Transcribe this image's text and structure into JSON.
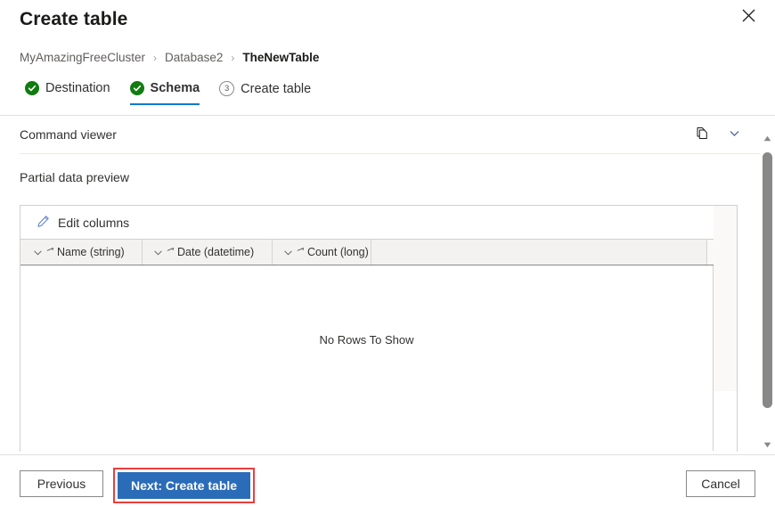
{
  "dialog": {
    "title": "Create table",
    "close_icon": "close-icon"
  },
  "breadcrumb": {
    "items": [
      {
        "label": "MyAmazingFreeCluster",
        "current": false
      },
      {
        "label": "Database2",
        "current": false
      },
      {
        "label": "TheNewTable",
        "current": true
      }
    ],
    "separator": "›"
  },
  "steps": [
    {
      "label": "Destination",
      "state": "done",
      "icon": "check-circle-icon"
    },
    {
      "label": "Schema",
      "state": "active-done",
      "icon": "check-circle-icon"
    },
    {
      "label": "Create table",
      "state": "pending",
      "number": "3"
    }
  ],
  "command_viewer": {
    "label": "Command viewer",
    "copy_icon": "copy-icon",
    "expand_icon": "chevron-down-icon"
  },
  "preview": {
    "label": "Partial data preview",
    "edit_columns_label": "Edit columns",
    "edit_icon": "pencil-icon",
    "add_column_icon": "plus-icon",
    "empty_message": "No Rows To Show",
    "columns": [
      {
        "name": "Name",
        "type": "string",
        "label": "Name (string)",
        "sort_icon": "chevron-down-icon",
        "type_icon": "string-type-icon"
      },
      {
        "name": "Date",
        "type": "datetime",
        "label": "Date (datetime)",
        "sort_icon": "chevron-down-icon",
        "type_icon": "string-type-icon"
      },
      {
        "name": "Count",
        "type": "long",
        "label": "Count (long)",
        "sort_icon": "chevron-down-icon",
        "type_icon": "string-type-icon"
      }
    ]
  },
  "scrollbar": {
    "up_icon": "scroll-up-arrow-icon",
    "down_icon": "scroll-down-arrow-icon"
  },
  "footer": {
    "previous_label": "Previous",
    "next_label": "Next: Create table",
    "cancel_label": "Cancel"
  },
  "colors": {
    "accent_blue": "#0078d4",
    "primary_button": "#2b6cb8",
    "highlight_red": "#ec3d3d",
    "success_green": "#107c10",
    "header_gray": "#f3f2f1"
  }
}
